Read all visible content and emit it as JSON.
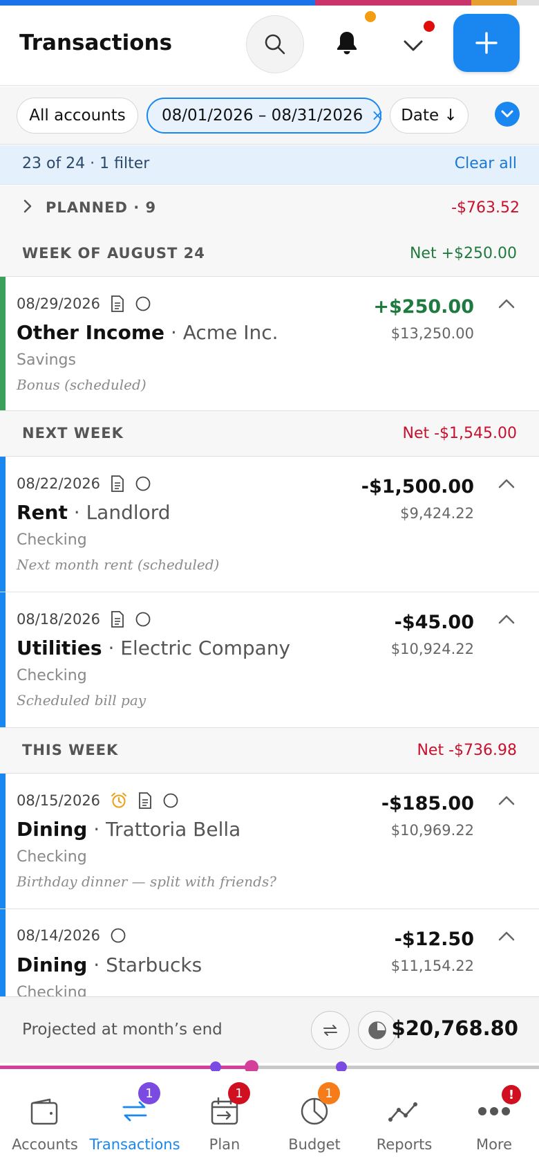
{
  "colors": {
    "accent": "#1a86f0",
    "positive": "#1f7a3f",
    "negative": "#c8102e",
    "income_bar": "#3aa05b",
    "expense_bar": "#1a86f0"
  },
  "top_stripe_colors": [
    "#1a73e8",
    "#c9356a",
    "#e6a030",
    "#e0e0e0"
  ],
  "header": {
    "title": "Transactions",
    "search_icon": "search-icon",
    "bell_icon": "bell-icon",
    "chevron_icon": "chevron-down-icon",
    "add_icon": "plus-icon"
  },
  "filters": {
    "accounts": "All accounts",
    "date_range": "08/01/2026 – 08/31/2026",
    "clear_x": "×",
    "sort": "Date ↓"
  },
  "info": {
    "count": "23 of 24 · 1 filter",
    "clear_all": "Clear all"
  },
  "planned": {
    "label": "PLANNED · 9",
    "amount": "-$763.52"
  },
  "weeks": [
    {
      "label": "WEEK OF AUGUST 24",
      "net": "Net +$250.00"
    },
    {
      "label": "NEXT WEEK",
      "net": "Net -$1,545.00"
    },
    {
      "label": "THIS WEEK",
      "net": "Net -$736.98"
    }
  ],
  "transactions": [
    {
      "date": "08/29/2026",
      "category": "Other Income",
      "payee": "· Acme Inc.",
      "account": "Savings",
      "memo": "Bonus (scheduled)",
      "amount": "+$250.00",
      "balance": "$13,250.00"
    },
    {
      "date": "08/22/2026",
      "category": "Rent",
      "payee": "· Landlord",
      "account": "Checking",
      "memo": "Next month rent (scheduled)",
      "amount": "-$1,500.00",
      "balance": "$9,424.22"
    },
    {
      "date": "08/18/2026",
      "category": "Utilities",
      "payee": "· Electric Company",
      "account": "Checking",
      "memo": "Scheduled bill pay",
      "amount": "-$45.00",
      "balance": "$10,924.22"
    },
    {
      "date": "08/15/2026",
      "category": "Dining",
      "payee": "· Trattoria Bella",
      "account": "Checking",
      "memo": "Birthday dinner — split with friends?",
      "amount": "-$185.00",
      "balance": "$10,969.22"
    },
    {
      "date": "08/14/2026",
      "category": "Dining",
      "payee": "· Starbucks",
      "account": "Checking",
      "memo": "",
      "amount": "-$12.50",
      "balance": "$11,154.22"
    }
  ],
  "projection": {
    "label": "Projected at month’s end",
    "total": "$20,768.80"
  },
  "tabs": [
    {
      "label": "Accounts",
      "icon": "wallet-icon",
      "badge": ""
    },
    {
      "label": "Transactions",
      "icon": "transfer-arrows-icon",
      "badge": "1"
    },
    {
      "label": "Plan",
      "icon": "calendar-arrow-icon",
      "badge": "1"
    },
    {
      "label": "Budget",
      "icon": "pie-chart-icon",
      "badge": "1"
    },
    {
      "label": "Reports",
      "icon": "line-chart-icon",
      "badge": ""
    },
    {
      "label": "More",
      "icon": "more-dots-icon",
      "badge": "!"
    }
  ]
}
